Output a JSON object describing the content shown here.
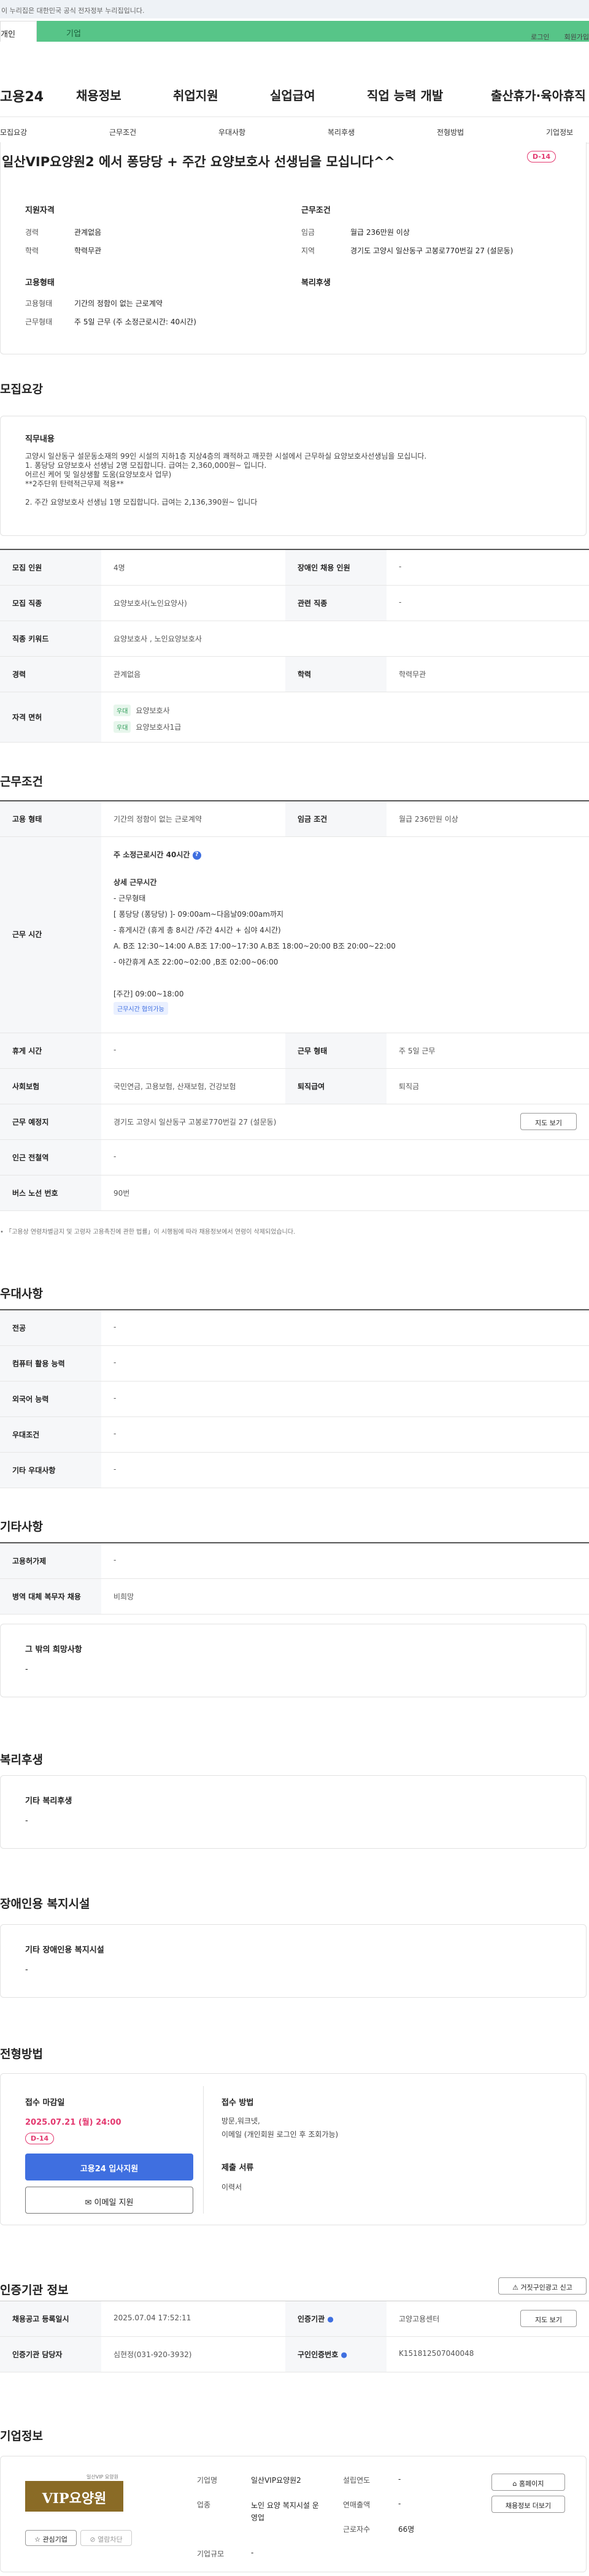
{
  "gov_notice": "이 누리집은 대한민국 공식 전자정부 누리집입니다.",
  "tabs": [
    "개인",
    "기업"
  ],
  "util": [
    "로그인",
    "회원가입"
  ],
  "logo": "고용24",
  "gnb": [
    "채용정보",
    "취업지원",
    "실업급여",
    "직업 능력 개발",
    "출산휴가·육아휴직"
  ],
  "lnb": [
    "모집요강",
    "근무조건",
    "우대사항",
    "복리후생",
    "전형방법",
    "기업정보"
  ],
  "title": "일산VIP요양원2 에서 퐁당당 + 주간 요양보호사 선생님을 모십니다^^",
  "dday": "D-14",
  "summary": {
    "qual_h": "지원자격",
    "career_l": "경력",
    "career_v": "관계없음",
    "edu_l": "학력",
    "edu_v": "학력무관",
    "cond_h": "근무조건",
    "wage_l": "임금",
    "wage_v": "월급 236만원 이상",
    "loc_l": "지역",
    "loc_v": "경기도 고양시 일산동구 고봉로770번길 27 (설문동)",
    "emp_h": "고용형태",
    "type_l": "고용형태",
    "type_v": "기간의 정함이 없는 근로계약",
    "work_l": "근무형태",
    "work_v": "주 5일 근무 (주 소정근로시간: 40시간)",
    "welfare_h": "복리후생"
  },
  "recruit": {
    "h": "모집요강",
    "job_h": "직무내용",
    "job_lines": [
      "고양시 일산동구 설문동소재의  99인 시설의 지하1층 지상4층의 쾌적하고 깨끗한 시설에서 근무하실 요양보호사선생님을 모십니다.",
      "1. 퐁당당 요양보호사 선생님 2명 모집합니다. 급여는 2,360,000원~ 입니다.",
      "어르신 케어 및 일상생활 도움(요양보호사 업무)",
      "**2주단위 탄력적근무제 적용**",
      "",
      "2. 주간 요양보호사 선생님 1명 모집합니다. 급여는 2,136,390원~ 입니다"
    ],
    "rows": [
      {
        "a": "모집 인원",
        "b": "4명",
        "c": "장애인 채용 인원",
        "d": "-"
      },
      {
        "a": "모집 직종",
        "b": "요양보호사(노인요양사)",
        "c": "관련 직종",
        "d": "-"
      },
      {
        "a": "직종 키워드",
        "b": "요양보호사 , 노인요양보호사"
      },
      {
        "a": "경력",
        "b": "관계없음",
        "c": "학력",
        "d": "학력무관"
      }
    ],
    "license_h": "자격 면허",
    "license_tag": "우대",
    "licenses": [
      "요양보호사",
      "요양보호사1급"
    ]
  },
  "cond": {
    "h": "근무조건",
    "type_h": "고용 형태",
    "type_v": "기간의 정함이 없는 근로계약",
    "wage_h": "임금 조건",
    "wage_v": "월급 236만원 이상",
    "time_h": "근무 시간",
    "hours": "주 소정근로시간 40시간",
    "detail_lines": [
      "상세 근무시간",
      "- 근무형태",
      "[ 퐁당당 (퐁당당) ]- 09:00am~다음날09:00am까지",
      "- 휴게시간 (휴게 총 8시간 /주간 4시간 + 심야 4시간)",
      "A. B조 12:30~14:00 A.B조 17:00~17:30  A.B조 18:00~20:00 B조 20:00~22:00",
      "- 야간휴게 A조 22:00~02:00 ,B조 02:00~06:00",
      "",
      "[주간] 09:00~18:00"
    ],
    "tag": "근무시간 협의가능",
    "rows": [
      {
        "a": "휴게 시간",
        "b": "-",
        "c": "근무 형태",
        "d": "주 5일 근무"
      },
      {
        "a": "사회보험",
        "b": "국민연금, 고용보험, 산재보험, 건강보험",
        "c": "퇴직급여",
        "d": "퇴직금"
      },
      {
        "a": "근무 예정지",
        "b": "경기도 고양시 일산동구 고봉로770번길 27 (설문동)",
        "btn": "지도 보기"
      },
      {
        "a": "인근 전철역",
        "b": "-"
      },
      {
        "a": "버스 노선 번호",
        "b": "90번"
      }
    ],
    "note": "「고용상 연령차별금지 및 고령자 고용촉진에 관한 법률」이 시행됨에 따라 채용정보에서 연령이 삭제되었습니다."
  },
  "pref": {
    "h": "우대사항",
    "rows": [
      [
        "전공",
        "-"
      ],
      [
        "컴퓨터 활용 능력",
        "-"
      ],
      [
        "외국어 능력",
        "-"
      ],
      [
        "우대조건",
        "-"
      ],
      [
        "기타 우대사항",
        "-"
      ]
    ]
  },
  "etc": {
    "h": "기타사항",
    "rows": [
      [
        "고용허가제",
        "-"
      ],
      [
        "병역 대체 복무자 채용",
        "비희망"
      ]
    ],
    "hope_h": "그 밖의 희망사항",
    "hope_v": "-"
  },
  "welfare": {
    "h": "복리후생",
    "box_h": "기타 복리후생",
    "box_v": "-"
  },
  "disab": {
    "h": "장애인용 복지시설",
    "box_h": "기타 장애인용 복지시설",
    "box_v": "-"
  },
  "apply": {
    "h": "전형방법",
    "deadline_h": "접수 마감일",
    "deadline": "2025.07.21 (월) 24:00",
    "dday": "D-14",
    "btn1": "고용24 입사지원",
    "btn2": "이메일 지원",
    "method_h": "접수 방법",
    "method_lines": [
      "방문,워크넷,",
      "이메일 (개인회원 로그인 후 조회가능)"
    ],
    "docs_h": "제출 서류",
    "docs_v": "이력서"
  },
  "cert": {
    "h": "인증기관 정보",
    "report": "거짓구인광고 신고",
    "rows": [
      {
        "a": "채용공고 등록일시",
        "b": "2025.07.04 17:52:11",
        "c": "인증기관",
        "d": "고양고용센터",
        "btn": "지도 보기"
      },
      {
        "a": "인증기관 담당자",
        "b": "심현정(031-920-3932)",
        "c": "구인인증번호",
        "d": "K151812507040048"
      }
    ]
  },
  "company": {
    "h": "기업정보",
    "logo_text": "VIP요양원",
    "logo_small": "일산VIP 요양원",
    "fav": "관심기업",
    "block": "열람차단",
    "name_l": "기업명",
    "name_v": "일산VIP요양원2",
    "ind_l": "업종",
    "ind_v": "노인 요양 복지시설 운영업",
    "size_l": "기업규모",
    "size_v": "-",
    "est_l": "설립연도",
    "est_v": "-",
    "sales_l": "연매출액",
    "sales_v": "-",
    "emp_l": "근로자수",
    "emp_v": "66명",
    "btn1": "홈페이지",
    "btn2": "채용정보 더보기"
  },
  "colors": {
    "green": "#57c588",
    "primary": "#3f6fe0",
    "dday": "#e3386f"
  }
}
